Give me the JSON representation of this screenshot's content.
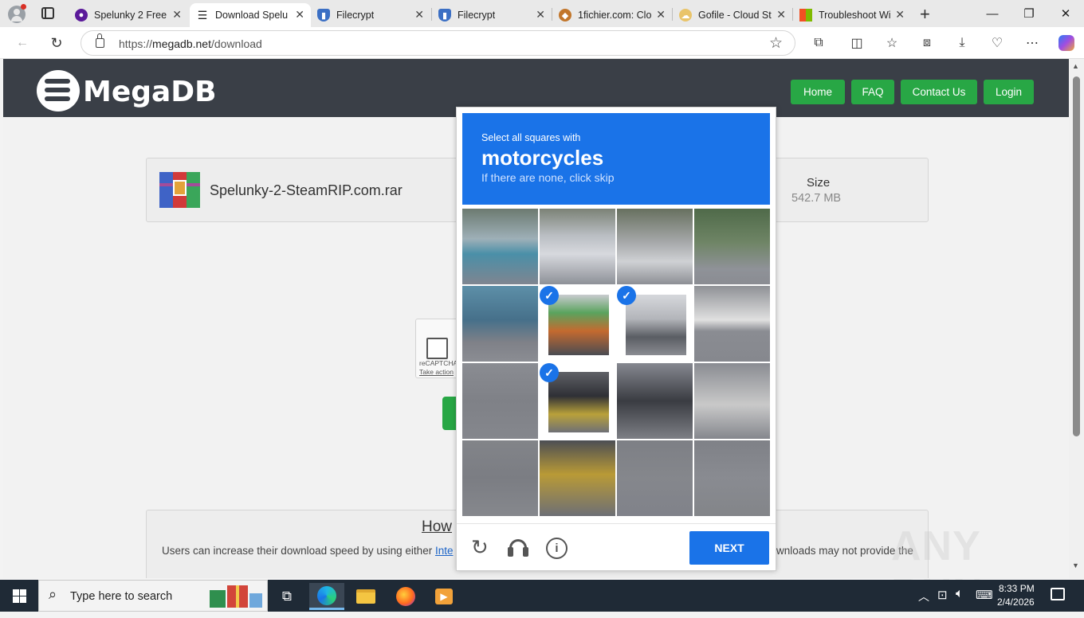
{
  "browser": {
    "tabs": [
      {
        "label": "Spelunky 2 Free",
        "active": false
      },
      {
        "label": "Download Spelu",
        "active": true
      },
      {
        "label": "Filecrypt",
        "active": false
      },
      {
        "label": "Filecrypt",
        "active": false
      },
      {
        "label": "1fichier.com: Clo",
        "active": false
      },
      {
        "label": "Gofile - Cloud St",
        "active": false
      },
      {
        "label": "Troubleshoot Wi",
        "active": false
      }
    ],
    "url_prefix": "https://",
    "url_domain": "megadb.net",
    "url_path": "/download"
  },
  "site": {
    "logo_text": "MegaDB",
    "nav": [
      "Home",
      "FAQ",
      "Contact Us",
      "Login"
    ],
    "file_name": "Spelunky-2-SteamRIP.com.rar",
    "size_label": "Size",
    "size_value": "542.7 MB",
    "recaptcha_label": "reCAPTCHA",
    "recaptcha_action": "Take action",
    "how_title": "How",
    "how_text_start": "Users can increase their download speed by using either",
    "how_link": "Inte",
    "how_text_end": "wnloads may not provide the"
  },
  "captcha": {
    "instruction": "Select all squares with",
    "target": "motorcycles",
    "hint": "If there are none, click skip",
    "next_label": "NEXT",
    "selected_cells": [
      5,
      6,
      9
    ]
  },
  "taskbar": {
    "search_placeholder": "Type here to search",
    "time": "8:33 PM",
    "date": "2/4/2026"
  },
  "watermark": "ANY RUN",
  "colors": {
    "accent": "#1a73e8",
    "site_green": "#28a745",
    "header_dark": "#3a3f47"
  }
}
